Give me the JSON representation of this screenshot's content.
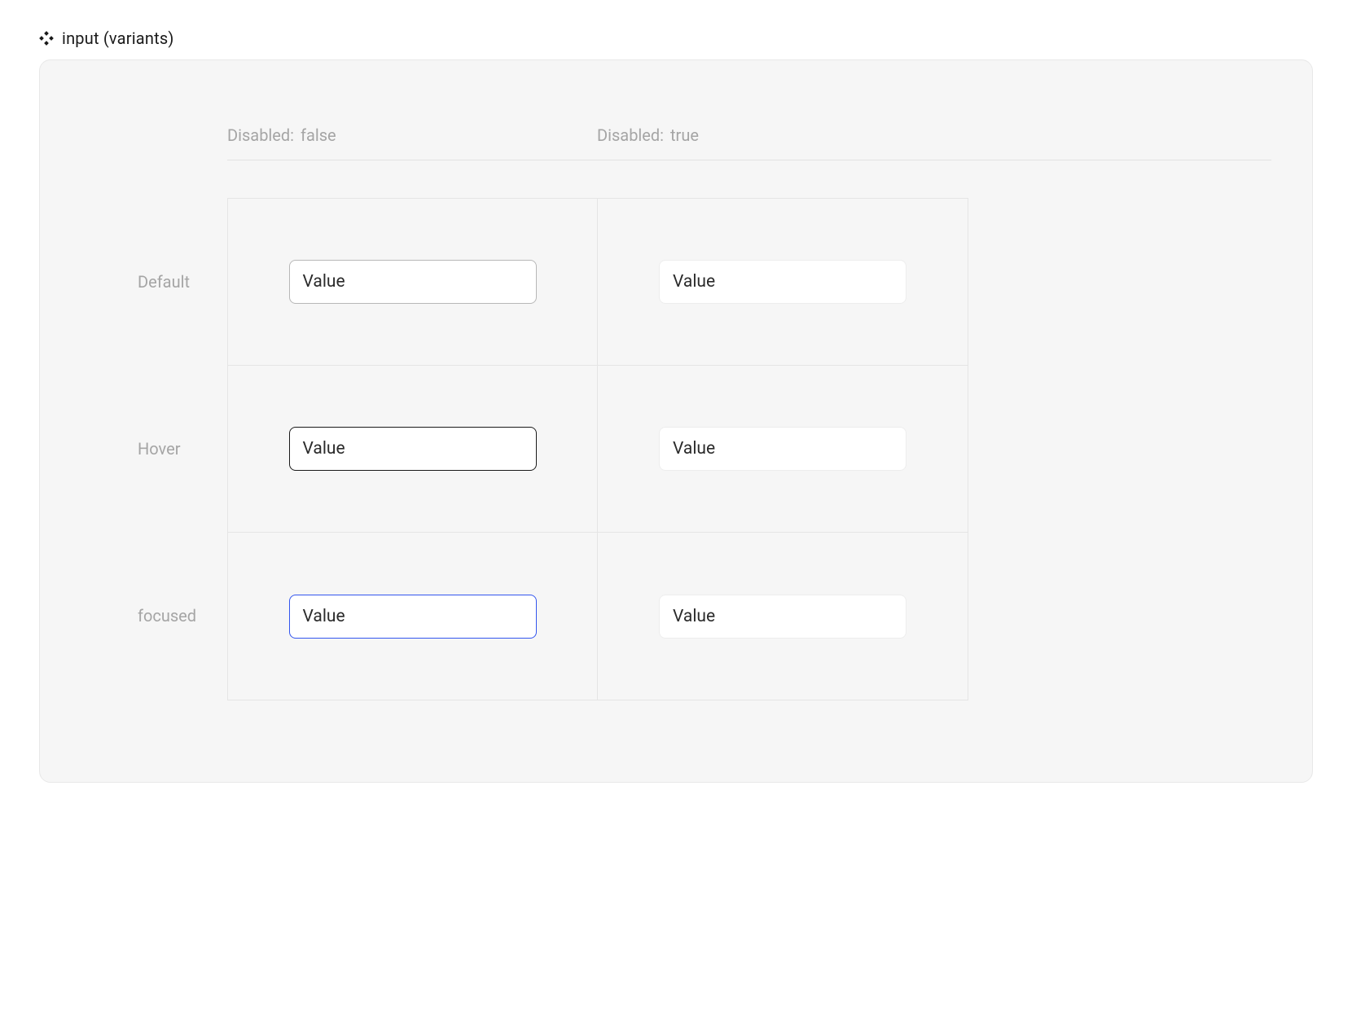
{
  "header": {
    "title": "input (variants)"
  },
  "columns": [
    {
      "property": "Disabled:",
      "value": "false"
    },
    {
      "property": "Disabled:",
      "value": "true"
    }
  ],
  "rows": [
    {
      "label": "Default"
    },
    {
      "label": "Hover"
    },
    {
      "label": "focused"
    }
  ],
  "cells": {
    "default_false": {
      "value": "Value"
    },
    "default_true": {
      "value": "Value"
    },
    "hover_false": {
      "value": "Value"
    },
    "hover_true": {
      "value": "Value"
    },
    "focused_false": {
      "value": "Value"
    },
    "focused_true": {
      "value": "Value"
    }
  }
}
